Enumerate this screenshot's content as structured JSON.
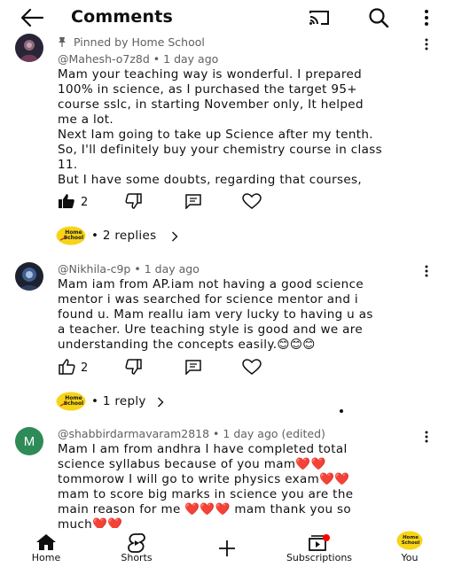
{
  "header": {
    "title": "Comments"
  },
  "comments": [
    {
      "pinned": "Pinned by Home School",
      "author": "@Mahesh-o7z8d",
      "age": "1 day ago",
      "lines": [
        "Mam your teaching way is wonderful. I prepared",
        "100% in science, as I purchased the target 95+",
        "course sslc, in starting November only, It helped",
        "me a lot.",
        "Next Iam going to take up Science after my tenth.",
        "So, I'll definitely buy your chemistry course in class",
        "11.",
        "But I have some doubts, regarding that courses,"
      ],
      "likes": "2",
      "replies": "2 replies"
    },
    {
      "author": "@Nikhila-c9p",
      "age": "1 day ago",
      "lines": [
        "Mam iam from AP.iam not having a good science",
        "mentor i was searched for science mentor and i",
        "found u. Mam reallu iam very lucky to having u as",
        "a teacher. Ure teaching style is good and we are",
        "understanding the concepts easily.😊😊😊"
      ],
      "likes": "2",
      "replies": "1 reply"
    },
    {
      "avatar_letter": "M",
      "author": "@shabbirdarmavaram2818",
      "age": "1 day ago (edited)",
      "lines": [
        "Mam I am from andhra I have completed total",
        "science syllabus because of you mam❤️❤️",
        "tommorow I will go to write physics exam❤️❤️",
        "mam to score big marks in science you are the",
        "main reason for me ❤️❤️❤️ mam thank you so",
        "much❤️❤️"
      ]
    }
  ],
  "separator": "•",
  "channel_logo_text": [
    "Home",
    "School"
  ],
  "bottom_nav": [
    {
      "label": "Home",
      "icon": "home-icon"
    },
    {
      "label": "Shorts",
      "icon": "shorts-icon"
    },
    {
      "label": "",
      "icon": "create-plus-icon"
    },
    {
      "label": "Subscriptions",
      "icon": "subscriptions-icon"
    },
    {
      "label": "You",
      "icon": "channel-avatar"
    }
  ],
  "colors": {
    "accent_red": "#ff0000",
    "secondary_text": "#606060",
    "avatar_green": "#2e8b57",
    "logo_yellow": "#f7d417"
  }
}
